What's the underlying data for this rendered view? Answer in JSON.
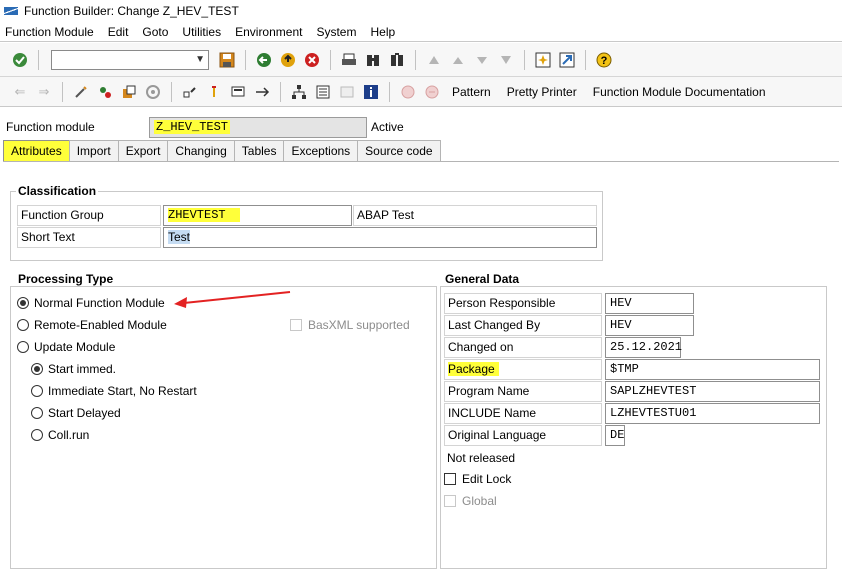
{
  "window": {
    "title": "Function Builder: Change Z_HEV_TEST"
  },
  "menu": [
    "Function Module",
    "Edit",
    "Goto",
    "Utilities",
    "Environment",
    "System",
    "Help"
  ],
  "toolbar2_buttons": {
    "pattern": "Pattern",
    "pretty_printer": "Pretty Printer",
    "fm_documentation": "Function Module Documentation"
  },
  "function_module": {
    "label": "Function module",
    "value": "Z_HEV_TEST",
    "status": "Active"
  },
  "tabs": [
    "Attributes",
    "Import",
    "Export",
    "Changing",
    "Tables",
    "Exceptions",
    "Source code"
  ],
  "classification": {
    "title": "Classification",
    "function_group_label": "Function Group",
    "function_group_value": "ZHEVTEST",
    "function_group_desc": "ABAP Test",
    "short_text_label": "Short Text",
    "short_text_value": "Test"
  },
  "processing_type": {
    "title": "Processing Type",
    "options": [
      "Normal Function Module",
      "Remote-Enabled Module",
      "Update Module"
    ],
    "basxml_label": "BasXML supported",
    "update_options": [
      "Start immed.",
      "Immediate Start, No Restart",
      "Start Delayed",
      "Coll.run"
    ]
  },
  "general_data": {
    "title": "General Data",
    "person_responsible_label": "Person Responsible",
    "person_responsible_value": "HEV",
    "last_changed_by_label": "Last Changed By",
    "last_changed_by_value": "HEV",
    "changed_on_label": "Changed on",
    "changed_on_value": "25.12.2021",
    "package_label": "Package",
    "package_value": "$TMP",
    "program_name_label": "Program Name",
    "program_name_value": "SAPLZHEVTEST",
    "include_name_label": "INCLUDE Name",
    "include_name_value": "LZHEVTESTU01",
    "original_language_label": "Original Language",
    "original_language_value": "DE",
    "not_released": "Not released",
    "edit_lock_label": "Edit Lock",
    "global_label": "Global"
  },
  "colors": {
    "highlight": "#ffff3a",
    "annotation_arrow": "#e32222"
  }
}
